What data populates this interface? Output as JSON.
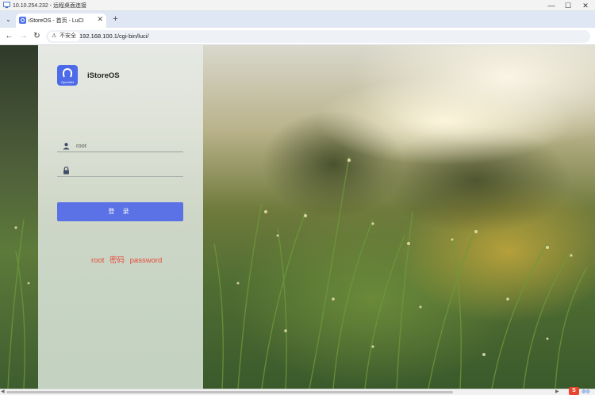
{
  "remote_window": {
    "title": "10.10.254.232 - 远程桌面连接",
    "minimize": "—",
    "maximize": "☐",
    "close": "✕"
  },
  "browser": {
    "tab_menu": "⌄",
    "tab_title": "iStoreOS - 首页 - LuCI",
    "tab_close": "✕",
    "new_tab": "+",
    "back": "←",
    "forward": "→",
    "reload": "↻",
    "security_warning": "不安全",
    "warning_icon": "⚠",
    "url": "192.168.100.1/cgi-bin/luci/"
  },
  "login": {
    "logo_caption": "OpenWrt",
    "brand": "iStoreOS",
    "username_value": "root",
    "password_value": "",
    "login_button": "登 录",
    "hint": "root 密码 password"
  },
  "colors": {
    "accent": "#5b71e6",
    "logo_bg": "#4d6be8",
    "hint": "#e74a3c"
  },
  "icons": {
    "user": "user-icon",
    "lock": "lock-icon"
  },
  "scrollbar": {
    "left_arrow": "◀",
    "right_arrow": "▶"
  },
  "tray": {
    "badge": "S",
    "extra": "◍◍"
  }
}
